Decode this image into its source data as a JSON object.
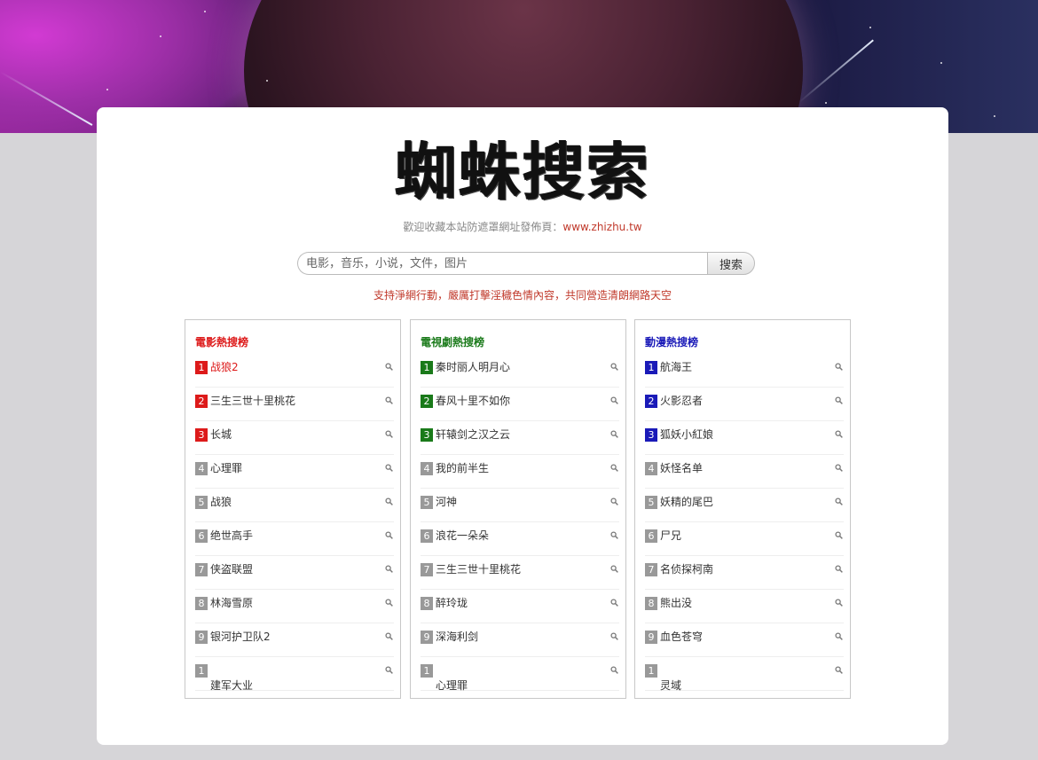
{
  "site": {
    "logo_text": "蜘蛛搜索",
    "welcome_text": "歡迎收藏本站防遮罩網址發佈頁：",
    "welcome_link": "www.zhizhu.tw",
    "search_placeholder": "电影，音乐，小说，文件，图片",
    "search_button": "搜索",
    "notice": "支持淨網行動，嚴厲打擊淫穢色情內容，共同營造清朗網路天空"
  },
  "colors": {
    "movie_accent": "#dd1a1a",
    "tv_accent": "#1a7a1a",
    "anime_accent": "#1a1ab8",
    "rank_default": "#999999"
  },
  "lists": [
    {
      "title": "電影熱搜榜",
      "items": [
        {
          "num": "1",
          "title": "战狼2"
        },
        {
          "num": "2",
          "title": "三生三世十里桃花"
        },
        {
          "num": "3",
          "title": "长城"
        },
        {
          "num": "4",
          "title": "心理罪"
        },
        {
          "num": "5",
          "title": "战狼"
        },
        {
          "num": "6",
          "title": "绝世高手"
        },
        {
          "num": "7",
          "title": "侠盗联盟"
        },
        {
          "num": "8",
          "title": "林海雪原"
        },
        {
          "num": "9",
          "title": "银河护卫队2"
        },
        {
          "num": "1",
          "title": "建军大业"
        }
      ]
    },
    {
      "title": "電視劇熱搜榜",
      "items": [
        {
          "num": "1",
          "title": "秦时丽人明月心"
        },
        {
          "num": "2",
          "title": "春风十里不如你"
        },
        {
          "num": "3",
          "title": "轩辕剑之汉之云"
        },
        {
          "num": "4",
          "title": "我的前半生"
        },
        {
          "num": "5",
          "title": "河神"
        },
        {
          "num": "6",
          "title": "浪花一朵朵"
        },
        {
          "num": "7",
          "title": "三生三世十里桃花"
        },
        {
          "num": "8",
          "title": "醉玲珑"
        },
        {
          "num": "9",
          "title": "深海利剑"
        },
        {
          "num": "1",
          "title": "心理罪"
        }
      ]
    },
    {
      "title": "動漫熱搜榜",
      "items": [
        {
          "num": "1",
          "title": "航海王"
        },
        {
          "num": "2",
          "title": "火影忍者"
        },
        {
          "num": "3",
          "title": "狐妖小紅娘"
        },
        {
          "num": "4",
          "title": "妖怪名单"
        },
        {
          "num": "5",
          "title": "妖精的尾巴"
        },
        {
          "num": "6",
          "title": "尸兄"
        },
        {
          "num": "7",
          "title": "名侦探柯南"
        },
        {
          "num": "8",
          "title": "熊出没"
        },
        {
          "num": "9",
          "title": "血色苍穹"
        },
        {
          "num": "1",
          "title": "灵域"
        }
      ]
    }
  ]
}
